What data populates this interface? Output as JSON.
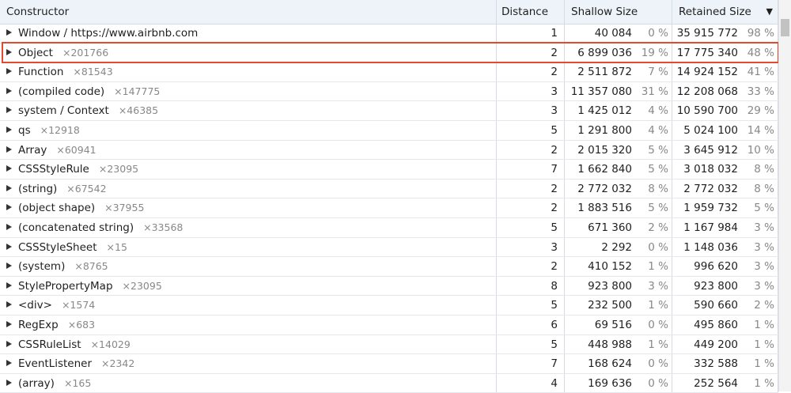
{
  "columns": {
    "constructor": "Constructor",
    "distance": "Distance",
    "shallow": "Shallow Size",
    "retained": "Retained Size",
    "sort_icon": "▼"
  },
  "rows": [
    {
      "name": "Window / https://www.airbnb.com",
      "count": "",
      "distance": "1",
      "shallow": "40 084",
      "shallow_pct": "0 %",
      "retained": "35 915 772",
      "retained_pct": "98 %"
    },
    {
      "name": "Object",
      "count": "×201766",
      "distance": "2",
      "shallow": "6 899 036",
      "shallow_pct": "19 %",
      "retained": "17 775 340",
      "retained_pct": "48 %"
    },
    {
      "name": "Function",
      "count": "×81543",
      "distance": "2",
      "shallow": "2 511 872",
      "shallow_pct": "7 %",
      "retained": "14 924 152",
      "retained_pct": "41 %"
    },
    {
      "name": "(compiled code)",
      "count": "×147775",
      "distance": "3",
      "shallow": "11 357 080",
      "shallow_pct": "31 %",
      "retained": "12 208 068",
      "retained_pct": "33 %"
    },
    {
      "name": "system / Context",
      "count": "×46385",
      "distance": "3",
      "shallow": "1 425 012",
      "shallow_pct": "4 %",
      "retained": "10 590 700",
      "retained_pct": "29 %"
    },
    {
      "name": "qs",
      "count": "×12918",
      "distance": "5",
      "shallow": "1 291 800",
      "shallow_pct": "4 %",
      "retained": "5 024 100",
      "retained_pct": "14 %"
    },
    {
      "name": "Array",
      "count": "×60941",
      "distance": "2",
      "shallow": "2 015 320",
      "shallow_pct": "5 %",
      "retained": "3 645 912",
      "retained_pct": "10 %"
    },
    {
      "name": "CSSStyleRule",
      "count": "×23095",
      "distance": "7",
      "shallow": "1 662 840",
      "shallow_pct": "5 %",
      "retained": "3 018 032",
      "retained_pct": "8 %"
    },
    {
      "name": "(string)",
      "count": "×67542",
      "distance": "2",
      "shallow": "2 772 032",
      "shallow_pct": "8 %",
      "retained": "2 772 032",
      "retained_pct": "8 %"
    },
    {
      "name": "(object shape)",
      "count": "×37955",
      "distance": "2",
      "shallow": "1 883 516",
      "shallow_pct": "5 %",
      "retained": "1 959 732",
      "retained_pct": "5 %"
    },
    {
      "name": "(concatenated string)",
      "count": "×33568",
      "distance": "5",
      "shallow": "671 360",
      "shallow_pct": "2 %",
      "retained": "1 167 984",
      "retained_pct": "3 %"
    },
    {
      "name": "CSSStyleSheet",
      "count": "×15",
      "distance": "3",
      "shallow": "2 292",
      "shallow_pct": "0 %",
      "retained": "1 148 036",
      "retained_pct": "3 %"
    },
    {
      "name": "(system)",
      "count": "×8765",
      "distance": "2",
      "shallow": "410 152",
      "shallow_pct": "1 %",
      "retained": "996 620",
      "retained_pct": "3 %"
    },
    {
      "name": "StylePropertyMap",
      "count": "×23095",
      "distance": "8",
      "shallow": "923 800",
      "shallow_pct": "3 %",
      "retained": "923 800",
      "retained_pct": "3 %"
    },
    {
      "name": "<div>",
      "count": "×1574",
      "distance": "5",
      "shallow": "232 500",
      "shallow_pct": "1 %",
      "retained": "590 660",
      "retained_pct": "2 %"
    },
    {
      "name": "RegExp",
      "count": "×683",
      "distance": "6",
      "shallow": "69 516",
      "shallow_pct": "0 %",
      "retained": "495 860",
      "retained_pct": "1 %"
    },
    {
      "name": "CSSRuleList",
      "count": "×14029",
      "distance": "5",
      "shallow": "448 988",
      "shallow_pct": "1 %",
      "retained": "449 200",
      "retained_pct": "1 %"
    },
    {
      "name": "EventListener",
      "count": "×2342",
      "distance": "7",
      "shallow": "168 624",
      "shallow_pct": "0 %",
      "retained": "332 588",
      "retained_pct": "1 %"
    },
    {
      "name": "(array)",
      "count": "×165",
      "distance": "4",
      "shallow": "169 636",
      "shallow_pct": "0 %",
      "retained": "252 564",
      "retained_pct": "1 %"
    }
  ],
  "highlight_color": "#e04a2f",
  "header_bg": "#eef3fa"
}
